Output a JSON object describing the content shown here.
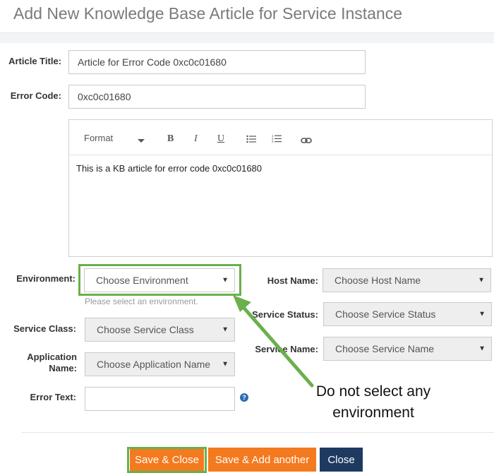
{
  "dialog": {
    "title": "Add New Knowledge Base Article for Service Instance"
  },
  "form": {
    "article_title_label": "Article Title:",
    "article_title_value": "Article for Error Code 0xc0c01680",
    "error_code_label": "Error Code:",
    "error_code_value": "0xc0c01680",
    "editor": {
      "format_label": "Format",
      "bold": "B",
      "italic": "I",
      "underline": "U",
      "body_text": "This is a KB article for error code 0xc0c01680"
    },
    "environment_label": "Environment:",
    "environment_placeholder": "Choose Environment",
    "environment_hint": "Please select an environment.",
    "service_class_label": "Service Class:",
    "service_class_placeholder": "Choose Service Class",
    "application_name_label_line1": "Application",
    "application_name_label_line2": "Name:",
    "application_name_placeholder": "Choose Application Name",
    "error_text_label": "Error Text:",
    "error_text_value": "",
    "help_glyph": "?",
    "host_name_label": "Host Name:",
    "host_name_placeholder": "Choose Host Name",
    "service_status_label": "Service Status:",
    "service_status_placeholder": "Choose Service Status",
    "service_name_label": "Service Name:",
    "service_name_placeholder": "Choose Service Name"
  },
  "annotation": {
    "line1": "Do not select any",
    "line2": "environment",
    "color": "#6ab04c"
  },
  "buttons": {
    "save_close": "Save & Close",
    "save_add_another": "Save & Add another",
    "close": "Close"
  },
  "colors": {
    "accent_orange": "#f47a1f",
    "navy": "#1f3a60",
    "highlight_green": "#6ab04c"
  }
}
